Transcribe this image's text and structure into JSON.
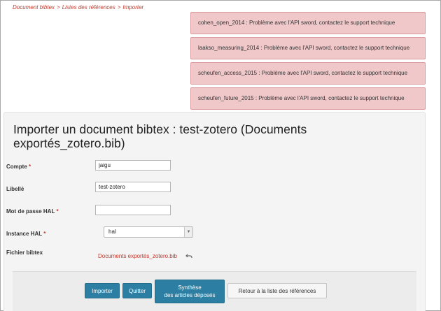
{
  "breadcrumb": {
    "items": [
      "Document bibtex",
      "Listes des références",
      "Importer"
    ],
    "separator": ">"
  },
  "alerts": [
    "cohen_open_2014 : Problème avec l'API sword, contactez le support technique",
    "laakso_measuring_2014 : Problème avec l'API sword, contactez le support technique",
    "scheufen_access_2015 : Problème avec l'API sword, contactez le support technique",
    "scheufen_future_2015 : Problème avec l'API sword, contactez le support technique"
  ],
  "panel": {
    "title": "Importer un document bibtex : test-zotero (Documents exportés_zotero.bib)"
  },
  "form": {
    "compte": {
      "label": "Compte",
      "required": "*",
      "value": "jaigu"
    },
    "libelle": {
      "label": "Libellé",
      "value": "test-zotero"
    },
    "password": {
      "label": "Mot de passe HAL",
      "required": "*",
      "value": ""
    },
    "instance": {
      "label": "Instance HAL",
      "required": "*",
      "selected": "hal"
    },
    "fichier": {
      "label": "Fichier bibtex",
      "filename": "Documents exportés_zotero.bib"
    }
  },
  "buttons": {
    "importer": "Importer",
    "quitter": "Quitter",
    "synthese_line1": "Synthèse",
    "synthese_line2": "des articles déposés",
    "retour": "Retour à la liste des références"
  },
  "colors": {
    "accent_red": "#c0392b",
    "alert_bg": "#f0c8ca",
    "primary_button": "#2c7fa2"
  }
}
